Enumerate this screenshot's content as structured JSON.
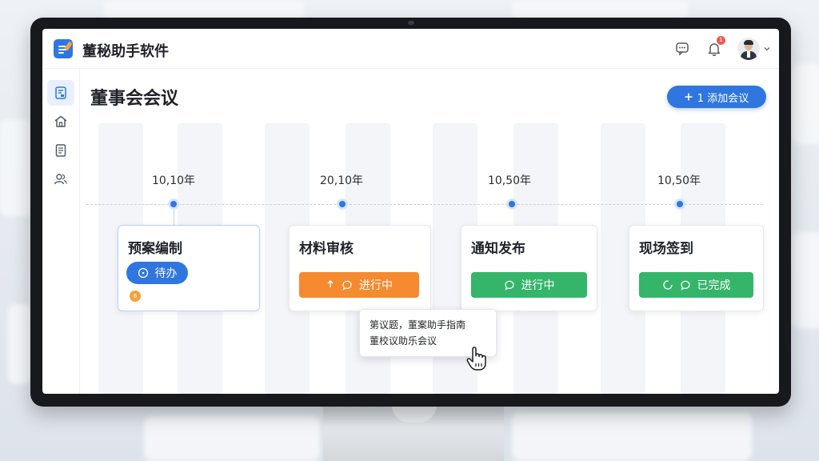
{
  "app": {
    "name": "董秘助手软件"
  },
  "header": {
    "notification_count": "1"
  },
  "page": {
    "title": "董事会会议",
    "add_button_label": "1 添加会议"
  },
  "timeline": [
    {
      "year": "10,10年",
      "title": "预案编制",
      "status": "待办",
      "badge": "6"
    },
    {
      "year": "20,10年",
      "title": "材料审核",
      "status": "进行中"
    },
    {
      "year": "10,50年",
      "title": "通知发布",
      "status": "进行中"
    },
    {
      "year": "10,50年",
      "title": "现场签到",
      "status": "已完成"
    }
  ],
  "tooltip": {
    "line1": "第议题，董案助手指南",
    "line2": "董校议助乐会议"
  },
  "colors": {
    "primary": "#2f76e0",
    "orange": "#f58a2f",
    "green": "#35b56a"
  },
  "icons": [
    "app-logo-icon",
    "chat-icon",
    "bell-icon",
    "chevron-down-icon",
    "document-icon",
    "home-icon",
    "file-icon",
    "users-icon",
    "plus-icon",
    "hand-cursor-icon"
  ]
}
